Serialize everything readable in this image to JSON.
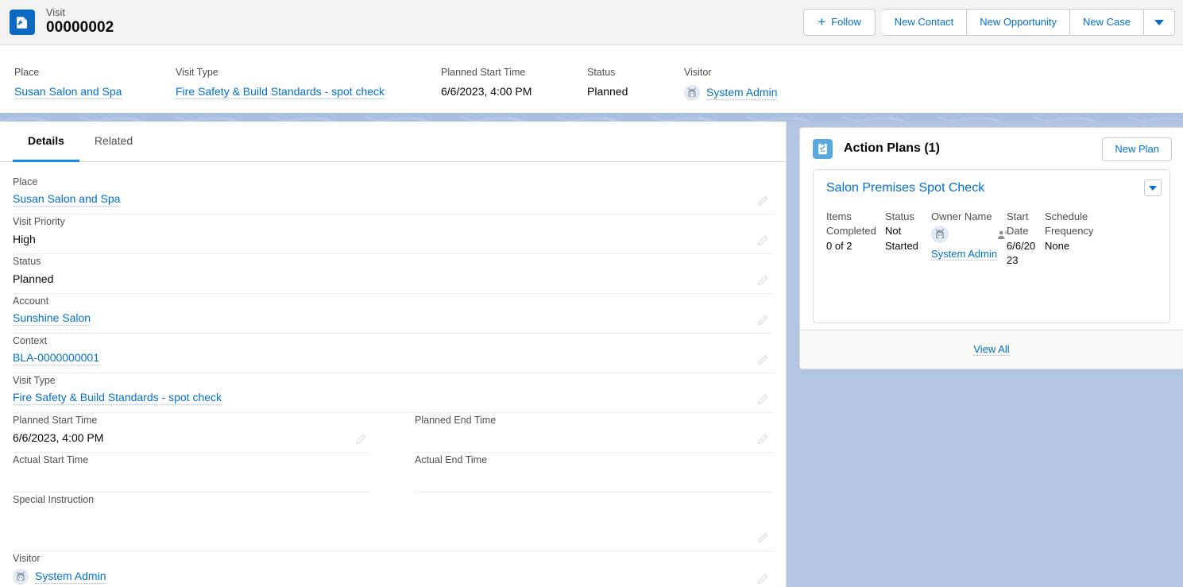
{
  "header": {
    "app_icon": "visit-record-icon",
    "eyebrow": "Visit",
    "title": "00000002",
    "actions": {
      "follow": "Follow",
      "new_contact": "New Contact",
      "new_opportunity": "New Opportunity",
      "new_case": "New Case",
      "more_caret": "chevron-down-icon"
    }
  },
  "highlights": [
    {
      "label": "Place",
      "value": "Susan Salon and Spa",
      "type": "link"
    },
    {
      "label": "Visit Type",
      "value": "Fire Safety & Build Standards - spot check",
      "type": "link"
    },
    {
      "label": "Planned Start Time",
      "value": "6/6/2023, 4:00 PM",
      "type": "text"
    },
    {
      "label": "Status",
      "value": "Planned",
      "type": "text"
    },
    {
      "label": "Visitor",
      "value": "System Admin",
      "type": "link-avatar"
    }
  ],
  "tabs": [
    {
      "label": "Details",
      "active": true
    },
    {
      "label": "Related",
      "active": false
    }
  ],
  "details": {
    "place": {
      "label": "Place",
      "value": "Susan Salon and Spa"
    },
    "visit_priority": {
      "label": "Visit Priority",
      "value": "High"
    },
    "status": {
      "label": "Status",
      "value": "Planned"
    },
    "account": {
      "label": "Account",
      "value": "Sunshine Salon"
    },
    "context": {
      "label": "Context",
      "value": "BLA-0000000001"
    },
    "visit_type": {
      "label": "Visit Type",
      "value": "Fire Safety & Build Standards - spot check"
    },
    "planned_start_time": {
      "label": "Planned Start Time",
      "value": "6/6/2023, 4:00 PM"
    },
    "planned_end_time": {
      "label": "Planned End Time",
      "value": ""
    },
    "actual_start_time": {
      "label": "Actual Start Time",
      "value": ""
    },
    "actual_end_time": {
      "label": "Actual End Time",
      "value": ""
    },
    "special_instruction": {
      "label": "Special Instruction",
      "value": ""
    },
    "visitor": {
      "label": "Visitor",
      "value": "System Admin"
    }
  },
  "action_plans": {
    "icon": "action-plan-checklist-icon",
    "title": "Action Plans (1)",
    "new_plan_label": "New Plan",
    "plan": {
      "title": "Salon Premises Spot Check",
      "items_completed_label": "Items Completed",
      "items_completed_value": "0 of 2",
      "status_label": "Status",
      "status_value": "Not Started",
      "owner_name_label": "Owner Name",
      "owner_name_value": "System Admin",
      "start_date_label": "Start Date",
      "start_date_value": "6/6/2023",
      "schedule_frequency_label": "Schedule Frequency",
      "schedule_frequency_value": "None"
    },
    "view_all_label": "View All"
  },
  "colors": {
    "brand_blue": "#0070d2",
    "app_icon_blue": "#0c6ac2",
    "panel_icon_blue": "#56aadf",
    "page_background": "#b3c5e0",
    "active_tab_underline": "#1589ee"
  }
}
